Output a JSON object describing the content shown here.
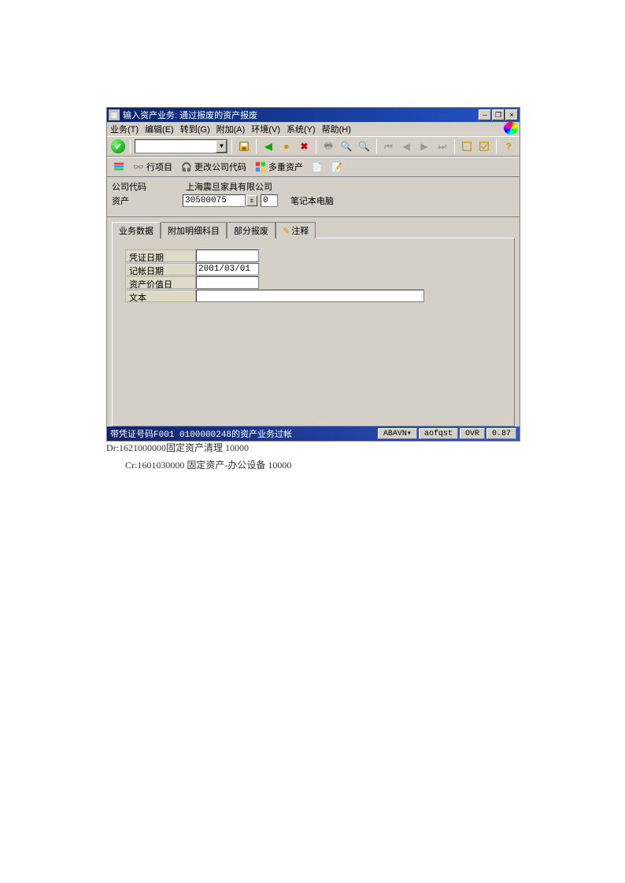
{
  "title": "输入资产业务: 通过报废的资产报废",
  "menu": {
    "items": [
      "业务(T)",
      "编辑(E)",
      "转到(G)",
      "附加(A)",
      "环境(V)",
      "系统(Y)",
      "帮助(H)"
    ]
  },
  "toolbar2": {
    "line_items": "行项目",
    "change_company": "更改公司代码",
    "multi_asset": "多重资产"
  },
  "header": {
    "company_label": "公司代码",
    "company_name": "上海震旦家具有限公司",
    "asset_label": "资产",
    "asset_no": "30500075",
    "asset_sub": "0",
    "asset_desc": "笔记本电脑"
  },
  "tabs": {
    "t1": "业务数据",
    "t2": "附加明细科目",
    "t3": "部分报废",
    "t4": "注释"
  },
  "form": {
    "doc_date_label": "凭证日期",
    "doc_date_value": "",
    "posting_date_label": "记帐日期",
    "posting_date_value": "2001/03/01",
    "value_date_label": "资产价值日",
    "value_date_value": "",
    "text_label": "文本",
    "text_value": ""
  },
  "status": {
    "message": "带凭证号码F001 0100000248的资产业务过帐",
    "tcode": "ABAVN",
    "user": "aofqst",
    "mode": "OVR",
    "time": "0.87"
  },
  "doc": {
    "line1": "Dr:1621000000固定资产清理    10000",
    "line2": "Cr:1601030000 固定资产-办公设备     10000"
  }
}
